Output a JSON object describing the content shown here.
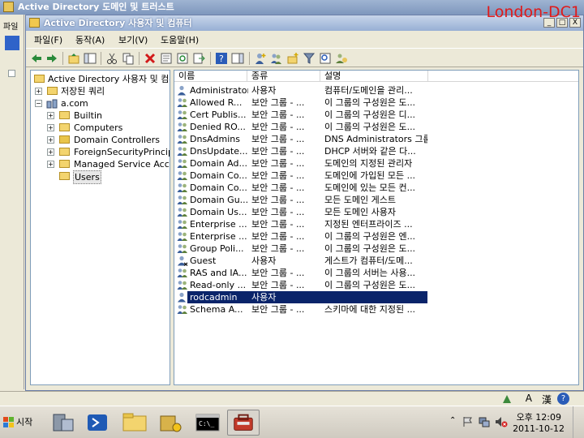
{
  "background_window": {
    "title": "Active Directory 도메인 및 트러스트",
    "menu_fragment": "파일"
  },
  "watermark": "London-DC1",
  "window": {
    "title": "Active Directory 사용자 및 컴퓨터",
    "controls": {
      "minimize": "_",
      "maximize": "□",
      "close": "X"
    }
  },
  "menu": {
    "file": "파일(F)",
    "action": "동작(A)",
    "view": "보기(V)",
    "help": "도움말(H)"
  },
  "tree": {
    "root": "Active Directory 사용자 및 컴퓨터",
    "saved_queries": "저장된 쿼리",
    "domain": "a.com",
    "children": [
      "Builtin",
      "Computers",
      "Domain Controllers",
      "ForeignSecurityPrincipals",
      "Managed Service Accounts",
      "Users"
    ]
  },
  "list": {
    "columns": [
      "이름",
      "종류",
      "설명"
    ],
    "rows": [
      {
        "name": "Administrator",
        "type": "사용자",
        "desc": "컴퓨터/도메인을 관리...",
        "kind": "user"
      },
      {
        "name": "Allowed R...",
        "type": "보안 그룹 - ...",
        "desc": "이 그룹의 구성원은 도...",
        "kind": "group"
      },
      {
        "name": "Cert Publis...",
        "type": "보안 그룹 - ...",
        "desc": "이 그룹의 구성원은 디...",
        "kind": "group"
      },
      {
        "name": "Denied RO...",
        "type": "보안 그룹 - ...",
        "desc": "이 그룹의 구성원은 도...",
        "kind": "group"
      },
      {
        "name": "DnsAdmins",
        "type": "보안 그룹 - ...",
        "desc": "DNS Administrators 그룹",
        "kind": "group"
      },
      {
        "name": "DnsUpdate...",
        "type": "보안 그룹 - ...",
        "desc": "DHCP 서버와 같은 다...",
        "kind": "group"
      },
      {
        "name": "Domain Ad...",
        "type": "보안 그룹 - ...",
        "desc": "도메인의 지정된 관리자",
        "kind": "group"
      },
      {
        "name": "Domain Co...",
        "type": "보안 그룹 - ...",
        "desc": "도메인에 가입된 모든 ...",
        "kind": "group"
      },
      {
        "name": "Domain Co...",
        "type": "보안 그룹 - ...",
        "desc": "도메인에 있는 모든 컨...",
        "kind": "group"
      },
      {
        "name": "Domain Gu...",
        "type": "보안 그룹 - ...",
        "desc": "모든 도메인 게스트",
        "kind": "group"
      },
      {
        "name": "Domain Us...",
        "type": "보안 그룹 - ...",
        "desc": "모든 도메인 사용자",
        "kind": "group"
      },
      {
        "name": "Enterprise ...",
        "type": "보안 그룹 - ...",
        "desc": "지정된 엔터프라이즈 ...",
        "kind": "group"
      },
      {
        "name": "Enterprise ...",
        "type": "보안 그룹 - ...",
        "desc": "이 그룹의 구성원은 엔...",
        "kind": "group"
      },
      {
        "name": "Group Poli...",
        "type": "보안 그룹 - ...",
        "desc": "이 그룹의 구성원은 도...",
        "kind": "group"
      },
      {
        "name": "Guest",
        "type": "사용자",
        "desc": "게스트가 컴퓨터/도메...",
        "kind": "user-disabled"
      },
      {
        "name": "RAS and IA...",
        "type": "보안 그룹 - ...",
        "desc": "이 그룹의 서버는 사용...",
        "kind": "group"
      },
      {
        "name": "Read-only ...",
        "type": "보안 그룹 - ...",
        "desc": "이 그룹의 구성원은 도...",
        "kind": "group"
      },
      {
        "name": "rodcadmin",
        "type": "사용자",
        "desc": "",
        "kind": "user",
        "selected": true
      },
      {
        "name": "Schema A...",
        "type": "보안 그룹 - ...",
        "desc": "스키마에 대한 지정된 ...",
        "kind": "group"
      }
    ]
  },
  "langbar": {
    "mode": "A",
    "hanja": "漢"
  },
  "taskbar": {
    "start_label": "시작",
    "clock_time": "오후 12:09",
    "clock_date": "2011-10-12"
  }
}
